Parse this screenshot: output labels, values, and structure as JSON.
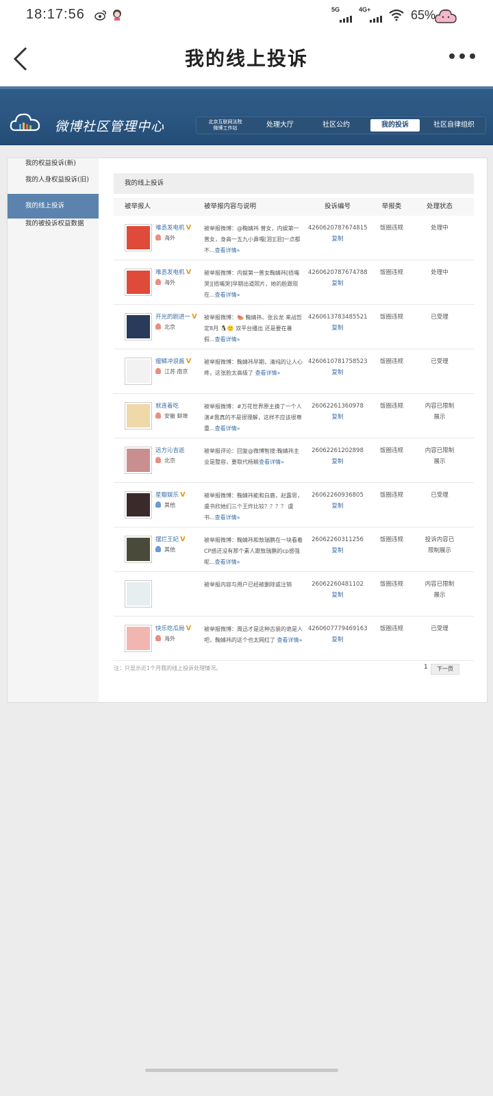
{
  "status_bar": {
    "time": "18:17:56",
    "signal1_label": "5G",
    "signal2_label": "4G+",
    "battery": "65%"
  },
  "header": {
    "title": "我的线上投诉"
  },
  "banner": {
    "logo_text": "微博社区管理中心",
    "nav": [
      {
        "label_line1": "北京互联网法院",
        "label_line2": "微博工作站"
      },
      {
        "label": "处理大厅"
      },
      {
        "label": "社区公约"
      },
      {
        "label": "我的投诉"
      },
      {
        "label": "社区自律组织"
      }
    ]
  },
  "sidebar": {
    "items": [
      {
        "label": "我的权益投诉(新)"
      },
      {
        "label": "我的人身权益投诉(旧)"
      },
      {
        "label": "我的线上投诉"
      },
      {
        "label": "我的被投诉权益数据"
      }
    ]
  },
  "content": {
    "section_title": "我的线上投诉",
    "columns": [
      "被举报人",
      "被举报内容与说明",
      "投诉编号",
      "举报类",
      "处理状态"
    ],
    "copy_label": "复制",
    "more_label": "查看详情»",
    "rows": [
      {
        "name": "难丞发电机",
        "verified": true,
        "location": "海外",
        "text": "被举报微博：@鞠婧祎 普女，内娱第一普女，身高一五九小鼻嘎[泪][泪]一点都不...",
        "id": "4260620787674815",
        "category": "饭圈违规",
        "status": "处理中",
        "status2": "",
        "avatar_color": "#e04a3a",
        "pin": "red"
      },
      {
        "name": "难丞发电机",
        "verified": true,
        "location": "海外",
        "text": "被举报微博：内娱第一普女鞠婧祎[捂嘴哭][捂嘴哭]早期出道照片，她的脸跟现在...",
        "id": "4260620787674788",
        "category": "饭圈违规",
        "status": "处理中",
        "status2": "",
        "avatar_color": "#e04a3a",
        "pin": "red"
      },
      {
        "name": "开光的剧进一",
        "verified": true,
        "location": "北京",
        "text": "被举报微博：🍉 鞠婧祎、张云龙 来战哲定8月 🐧🙂 双平台播出 还是要在暑假...",
        "id": "4260613783485521",
        "category": "饭圈违规",
        "status": "已受理",
        "status2": "",
        "avatar_color": "#2a3a5a",
        "pin": "red"
      },
      {
        "name": "瘤鳞冲浪酱",
        "verified": true,
        "location": "江苏 南京",
        "text": "被举报微博：鞠婧祎早期，清纯的让人心疼，这张脸太高级了 ",
        "id": "4260610781758523",
        "category": "饭圈违规",
        "status": "已受理",
        "status2": "",
        "avatar_color": "#f2f2f2",
        "pin": "red"
      },
      {
        "name": "就连着吃",
        "verified": false,
        "location": "安徽 蚌埠",
        "text": "被举报微博：#万花世界原主换了一个人演#我真的不是很理解，这样不应该很尊重...",
        "id": "26062261360978",
        "category": "饭圈违规",
        "status": "内容已限制",
        "status2": "展示",
        "avatar_color": "#f0d9a8",
        "pin": "red"
      },
      {
        "name": "远方沁吉逝",
        "verified": false,
        "location": "北京",
        "text": "被举报评论：回复@微博智搜:鞠婧祎主业是整容，要取代杨颖",
        "id": "26062261202898",
        "category": "饭圈违规",
        "status": "内容已限制",
        "status2": "展示",
        "avatar_color": "#c98f8f",
        "pin": "red"
      },
      {
        "name": "星瓣娱乐",
        "verified": true,
        "location": "其他",
        "text": "被举报微博：鞠婧祎能和白鹿，赵露思，虞书欣她们三个王炸比较？？？？ 虞书...",
        "id": "26062260936805",
        "category": "饭圈违规",
        "status": "已受理",
        "status2": "",
        "avatar_color": "#3a2a2a",
        "pin": "blue"
      },
      {
        "name": "摆烂王妃",
        "verified": true,
        "location": "其他",
        "text": "被举报微博：鞠婧祎和敖瑞鹏在一块看着CP感还没有那个素人跟敖瑞鹏的cp感强呢...",
        "id": "26062260311256",
        "category": "饭圈违规",
        "status": "投诉内容已",
        "status2": "限制展示",
        "avatar_color": "#4a4a3a",
        "pin": "blue"
      },
      {
        "name": "",
        "verified": false,
        "location": "",
        "text": "被举报内容与用户已经被删除或注销",
        "id": "26062260481102",
        "category": "饭圈违规",
        "status": "内容已限制",
        "status2": "展示",
        "avatar_color": "#e6eef0",
        "pin": ""
      },
      {
        "name": "快乐吃瓜局",
        "verified": true,
        "location": "海外",
        "text": "被举报微博：周迅才是这种古装的诡是人吧，鞠婧祎的这个也太网红了 ",
        "id": "4260607779469163",
        "category": "饭圈违规",
        "status": "已受理",
        "status2": "",
        "avatar_color": "#f2b6b0",
        "pin": "red"
      }
    ],
    "footer_note": "注：只显示近1个月我的线上投诉处理情况。",
    "page_number": "1",
    "next_page": "下一页"
  }
}
